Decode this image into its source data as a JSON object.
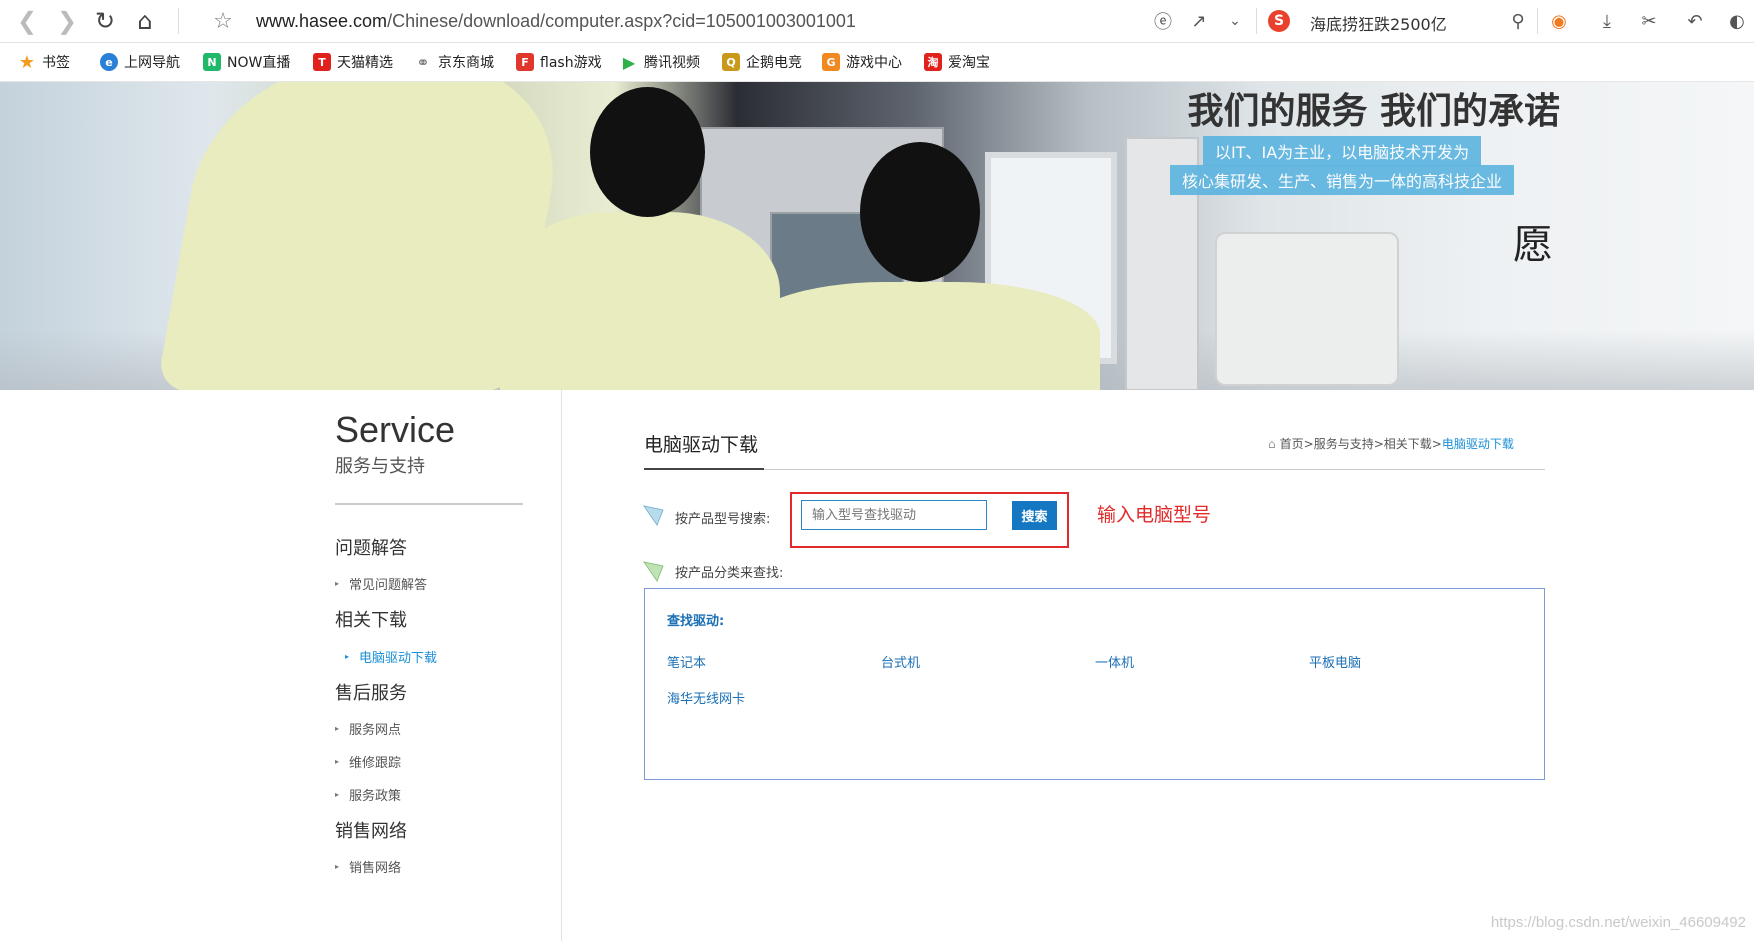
{
  "browser": {
    "url_host": "www.hasee.com",
    "url_path": "/Chinese/download/computer.aspx?cid=105001003001001",
    "search_engine_badge": "S",
    "hot_search": "海底捞狂跌2500亿",
    "icons": [
      "back-icon",
      "forward-icon",
      "reload-icon",
      "home-icon",
      "star-icon",
      "ie-mode-icon",
      "share-icon",
      "chevron-down-icon",
      "search-icon",
      "game-icon",
      "download-icon",
      "scissors-icon",
      "undo-icon"
    ]
  },
  "bookmarks": [
    {
      "label": "书签",
      "icon": "star-icon",
      "color": "#f29c1f"
    },
    {
      "label": "上网导航",
      "icon": "ie-icon",
      "color": "#2a7fd6"
    },
    {
      "label": "NOW直播",
      "icon": "now-icon",
      "color": "#20b86a"
    },
    {
      "label": "天猫精选",
      "icon": "tmall-icon",
      "color": "#e0211c"
    },
    {
      "label": "京东商城",
      "icon": "globe-icon",
      "color": "#777777"
    },
    {
      "label": "flash游戏",
      "icon": "flash-icon",
      "color": "#e0372c"
    },
    {
      "label": "腾讯视频",
      "icon": "play-icon",
      "color": "#2db04a"
    },
    {
      "label": "企鹅电竞",
      "icon": "penguin-icon",
      "color": "#c99a1a"
    },
    {
      "label": "游戏中心",
      "icon": "gamepad-icon",
      "color": "#f08a20"
    },
    {
      "label": "爱淘宝",
      "icon": "taobao-icon",
      "color": "#e0211c"
    }
  ],
  "banner": {
    "title": "我们的服务 我们的承诺",
    "subtitle_1": "以IT、IA为主业，以电脑技术开发为",
    "subtitle_2": "核心集研发、生产、销售为一体的高科技企业",
    "logo_glyph": "愿"
  },
  "sidebar": {
    "service": "Service",
    "service_cn": "服务与支持",
    "sections": [
      {
        "title": "问题解答",
        "items": [
          {
            "label": "常见问题解答",
            "active": false
          }
        ]
      },
      {
        "title": "相关下载",
        "items": [
          {
            "label": "电脑驱动下载",
            "active": true
          }
        ]
      },
      {
        "title": "售后服务",
        "items": [
          {
            "label": "服务网点",
            "active": false
          },
          {
            "label": "维修跟踪",
            "active": false
          },
          {
            "label": "服务政策",
            "active": false
          }
        ]
      },
      {
        "title": "销售网络",
        "items": [
          {
            "label": "销售网络",
            "active": false
          }
        ]
      }
    ]
  },
  "main": {
    "title": "电脑驱动下载",
    "breadcrumb": {
      "home": "首页",
      "sep": ">",
      "level1": "服务与支持",
      "level2": "相关下载",
      "current": "电脑驱动下载"
    },
    "search_label": "按产品型号搜索:",
    "search_placeholder": "输入型号查找驱动",
    "search_button": "搜索",
    "annotation": "输入电脑型号",
    "category_label": "按产品分类来查找:",
    "category_box_title": "查找驱动:",
    "categories": [
      "笔记本",
      "台式机",
      "一体机",
      "平板电脑",
      "海华无线网卡"
    ]
  },
  "watermark": "https://blog.csdn.net/weixin_46609492",
  "colors": {
    "accent": "#1a8fd6",
    "button": "#1577c2",
    "annotation": "#e12a2a",
    "link": "#1a6fb5"
  }
}
